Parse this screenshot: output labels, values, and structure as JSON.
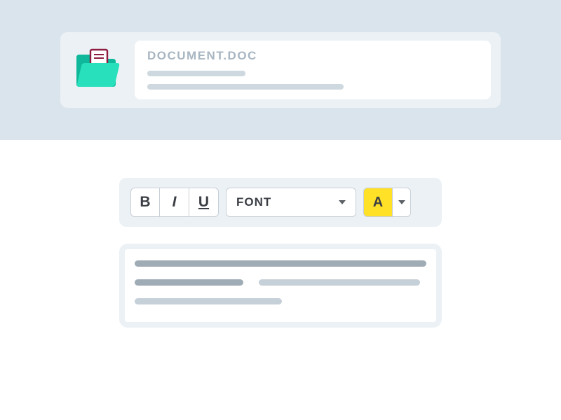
{
  "header": {
    "filename": "DOCUMENT.DOC"
  },
  "toolbar": {
    "bold": "B",
    "italic": "I",
    "underline": "U",
    "font_label": "FONT",
    "color_label": "A"
  }
}
